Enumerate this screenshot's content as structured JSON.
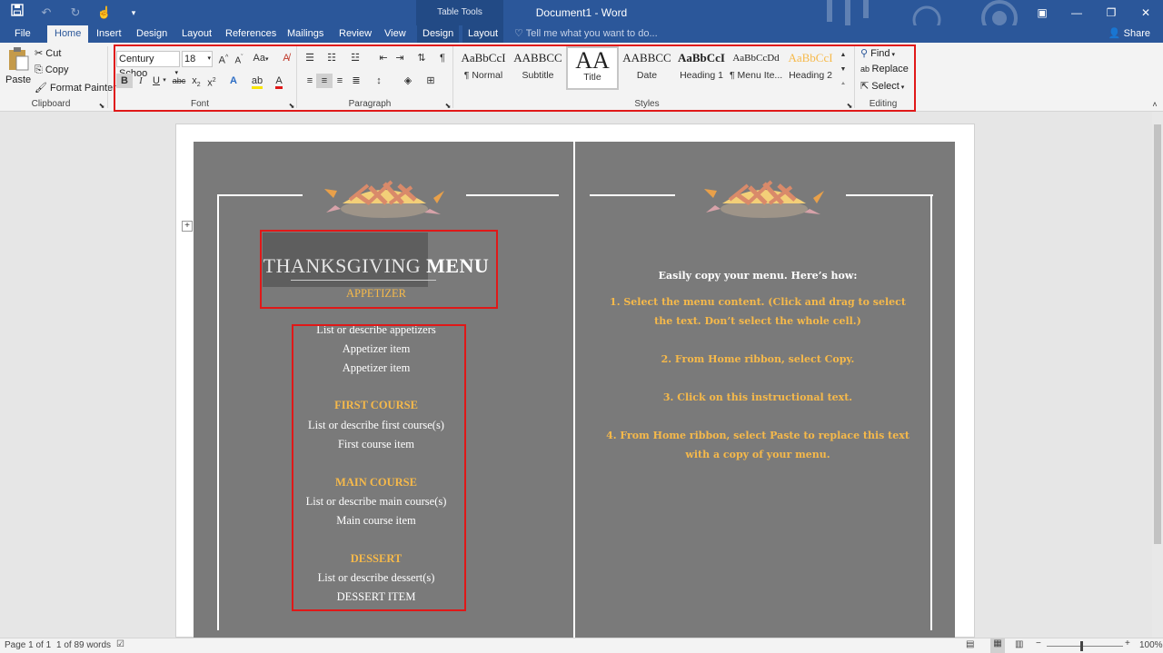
{
  "window": {
    "title": "Document1 - Word",
    "context_tab_group": "Table Tools"
  },
  "tabs": [
    "File",
    "Home",
    "Insert",
    "Design",
    "Layout",
    "References",
    "Mailings",
    "Review",
    "View",
    "Design",
    "Layout"
  ],
  "tell_me": "Tell me what you want to do...",
  "share": "Share",
  "clipboard": {
    "paste": "Paste",
    "cut": "Cut",
    "copy": "Copy",
    "format_painter": "Format Painter",
    "label": "Clipboard"
  },
  "font": {
    "name": "Century Schoo",
    "size": "18",
    "label": "Font",
    "case_label": "Aa"
  },
  "paragraph": {
    "label": "Paragraph"
  },
  "styles": {
    "label": "Styles",
    "items": [
      {
        "preview": "AaBbCcI",
        "name": "¶ Normal"
      },
      {
        "preview": "AABBCC",
        "name": "Subtitle"
      },
      {
        "preview": "AA",
        "name": "Title"
      },
      {
        "preview": "AABBCC",
        "name": "Date"
      },
      {
        "preview": "AaBbCcI",
        "name": "Heading 1"
      },
      {
        "preview": "AaBbCcDd",
        "name": "¶ Menu Ite..."
      },
      {
        "preview": "AaBbCcI",
        "name": "Heading 2"
      }
    ]
  },
  "editing": {
    "find": "Find",
    "replace": "Replace",
    "select": "Select",
    "label": "Editing"
  },
  "document": {
    "menu_title_a": "THANKSGIVING",
    "menu_title_b": "MENU",
    "sections": [
      {
        "heading": "APPETIZER",
        "items": [
          "List or describe appetizers",
          "Appetizer item",
          "Appetizer item"
        ]
      },
      {
        "heading": "FIRST COURSE",
        "items": [
          "List or describe first course(s)",
          "First course item"
        ]
      },
      {
        "heading": "MAIN COURSE",
        "items": [
          "List or describe main course(s)",
          "Main course item"
        ]
      },
      {
        "heading": "DESSERT",
        "items": [
          "List or describe dessert(s)",
          "DESSERT ITEM"
        ]
      }
    ],
    "instructions": {
      "intro": "Easily copy your menu. Here’s how:",
      "steps": [
        "1. Select the menu content. (Click and drag to select the text. Don’t select the whole cell.)",
        "2. From Home ribbon, select Copy.",
        "3. Click on this instructional text.",
        "4. From Home ribbon, select Paste to replace this text with a copy of your menu."
      ]
    }
  },
  "status": {
    "page": "Page 1 of 1",
    "words": "1 of 89 words",
    "zoom": "100%"
  },
  "colors": {
    "accent": "#2b579a",
    "menu_gold": "#f6b94a",
    "cell_gray": "#7a7a7a",
    "highlight_red": "#e01818"
  }
}
